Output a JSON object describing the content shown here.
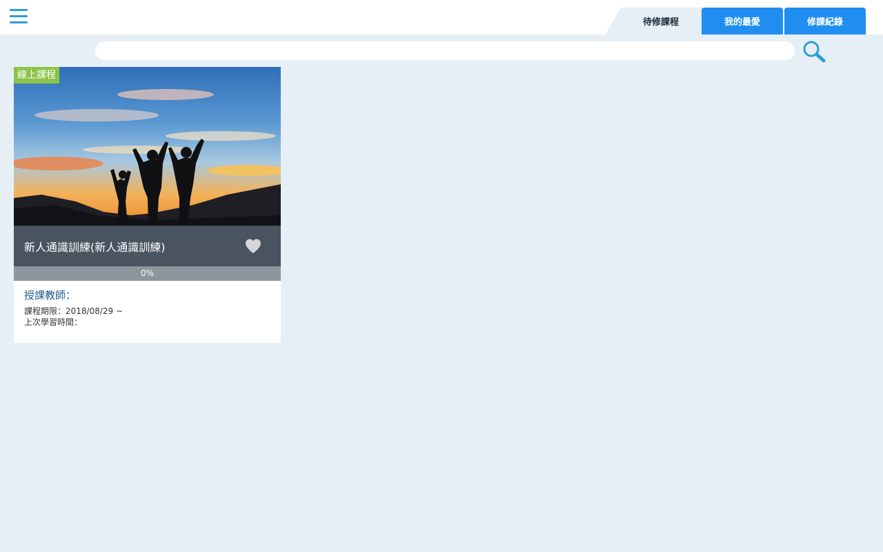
{
  "header": {
    "tabs": [
      {
        "label": "待修課程",
        "active": true
      },
      {
        "label": "我的最愛",
        "active": false
      },
      {
        "label": "修課紀錄",
        "active": false
      }
    ]
  },
  "search": {
    "value": "",
    "placeholder": ""
  },
  "colors": {
    "accent": "#1f8ef0",
    "menu_icon": "#2a9fd8",
    "badge": "#8bc34a",
    "background": "#e6eff5",
    "title_bar": "#4a5360"
  },
  "icons": {
    "menu": "hamburger-menu-icon",
    "search": "magnifier-search-icon",
    "favorite": "heart-icon"
  },
  "courses": [
    {
      "badge": "線上課程",
      "title": "新人通識訓練(新人通識訓練)",
      "progress_label": "0%",
      "progress": 0,
      "teacher_label": "授課教師：",
      "period_label": "課程期限：2018/08/29 ~",
      "last_study_label": "上次學習時間："
    }
  ]
}
